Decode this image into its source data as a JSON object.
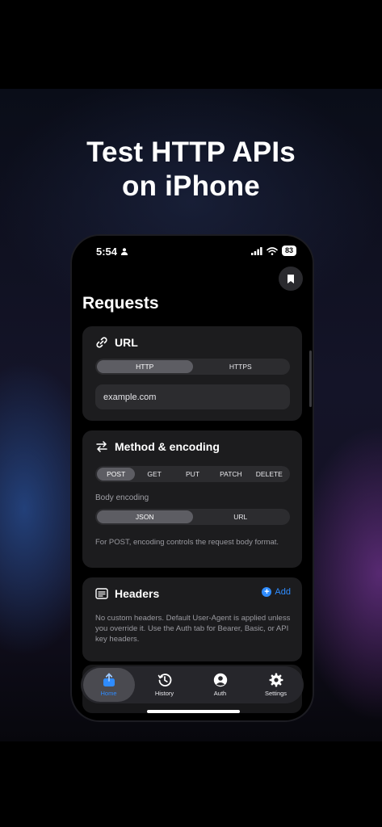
{
  "headline": {
    "line1": "Test HTTP APIs",
    "line2": "on iPhone"
  },
  "status_bar": {
    "time": "5:54",
    "battery": "83"
  },
  "page": {
    "title": "Requests"
  },
  "url_card": {
    "title": "URL",
    "scheme_options": [
      "HTTP",
      "HTTPS"
    ],
    "selected_scheme": "HTTP",
    "url_value": "example.com"
  },
  "method_card": {
    "title": "Method & encoding",
    "methods": [
      "POST",
      "GET",
      "PUT",
      "PATCH",
      "DELETE"
    ],
    "selected_method": "POST",
    "body_encoding_label": "Body encoding",
    "encodings": [
      "JSON",
      "URL"
    ],
    "selected_encoding": "JSON",
    "help": "For POST, encoding controls the request body format."
  },
  "headers_card": {
    "title": "Headers",
    "add_label": "Add",
    "help": "No custom headers. Default User-Agent is applied unless you override it. Use the Auth tab for Bearer, Basic, or API key headers."
  },
  "tabbar": {
    "items": [
      {
        "label": "Home",
        "icon": "upload-tray-icon",
        "active": true
      },
      {
        "label": "History",
        "icon": "history-clock-icon",
        "active": false
      },
      {
        "label": "Auth",
        "icon": "person-circle-icon",
        "active": false
      },
      {
        "label": "Settings",
        "icon": "gear-icon",
        "active": false
      }
    ]
  },
  "colors": {
    "accent": "#2f8cff",
    "card": "#1c1c1e",
    "segment_active": "#5d5d63"
  }
}
